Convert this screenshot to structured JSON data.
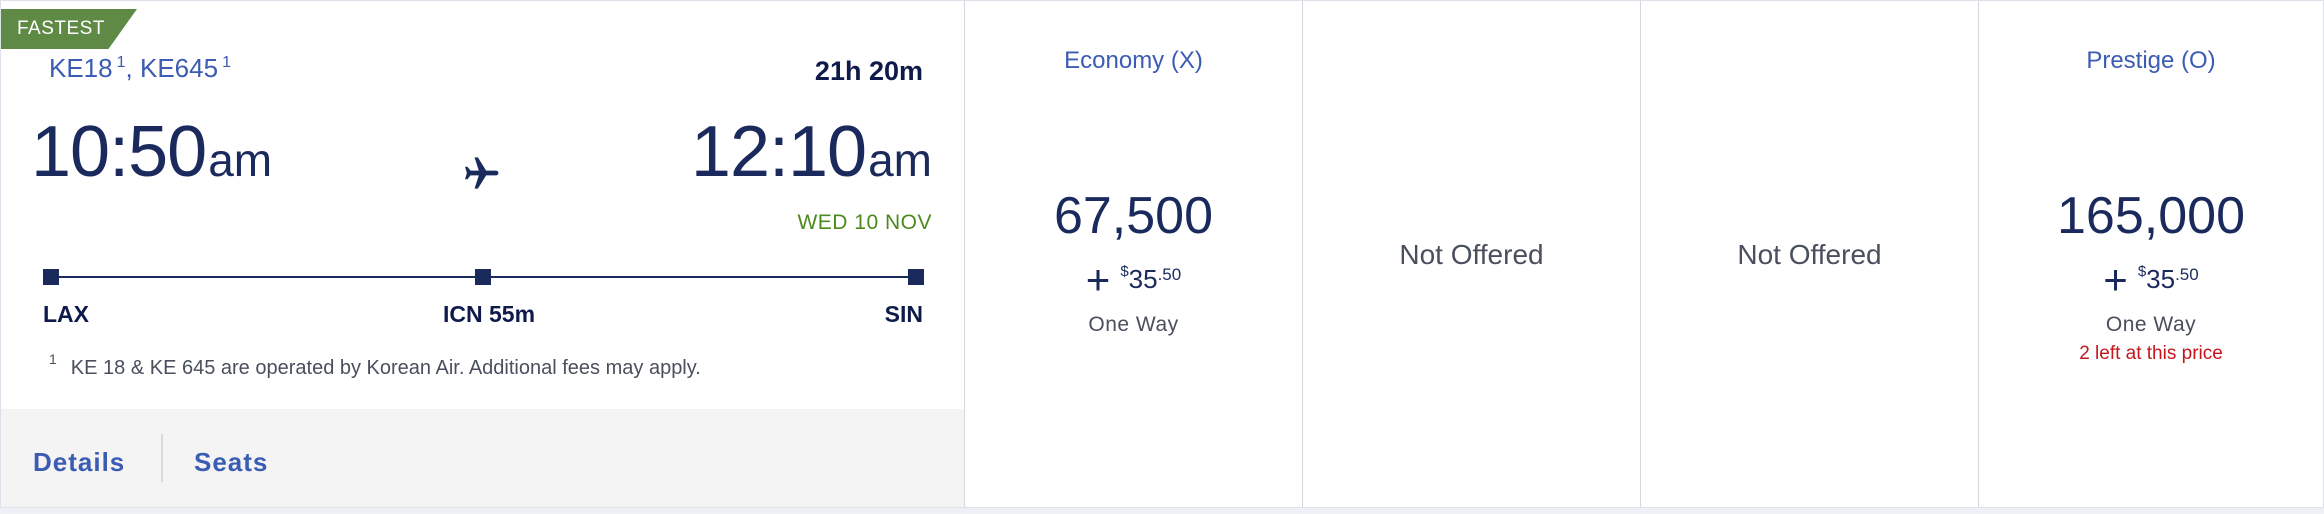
{
  "flight": {
    "badge": "FASTEST",
    "segments": [
      {
        "number": "KE18",
        "footnote": "1"
      },
      {
        "number": "KE645",
        "footnote": "1"
      }
    ],
    "separator": ",",
    "duration": "21h 20m",
    "depart": {
      "time": "10:50",
      "period": "am"
    },
    "arrive": {
      "time": "12:10",
      "period": "am",
      "date": "WED 10 NOV"
    },
    "stops": [
      {
        "label": "LAX"
      },
      {
        "label": "ICN 55m"
      },
      {
        "label": "SIN"
      }
    ],
    "footnote": {
      "marker": "1",
      "text": "KE 18 & KE 645 are operated by Korean Air. Additional fees may apply."
    },
    "actions": {
      "details": "Details",
      "seats": "Seats"
    }
  },
  "fares": [
    {
      "cabin": "Economy (X)",
      "miles": "67,500",
      "fee_plus": "+",
      "fee_currency": "$",
      "fee_dollars": "35",
      "fee_cents": ".50",
      "trip": "One Way"
    },
    {
      "status": "Not Offered"
    },
    {
      "status": "Not Offered"
    },
    {
      "cabin": "Prestige (O)",
      "miles": "165,000",
      "fee_plus": "+",
      "fee_currency": "$",
      "fee_dollars": "35",
      "fee_cents": ".50",
      "trip": "One Way",
      "availability": "2 left at this price"
    }
  ],
  "colors": {
    "badge_green": "#5f8a45",
    "link_blue": "#3c5cb3",
    "navy": "#1b2a5c",
    "date_green": "#4c8a1d",
    "alert_red": "#c4161c"
  },
  "icons": {
    "plane": "airplane-icon"
  }
}
